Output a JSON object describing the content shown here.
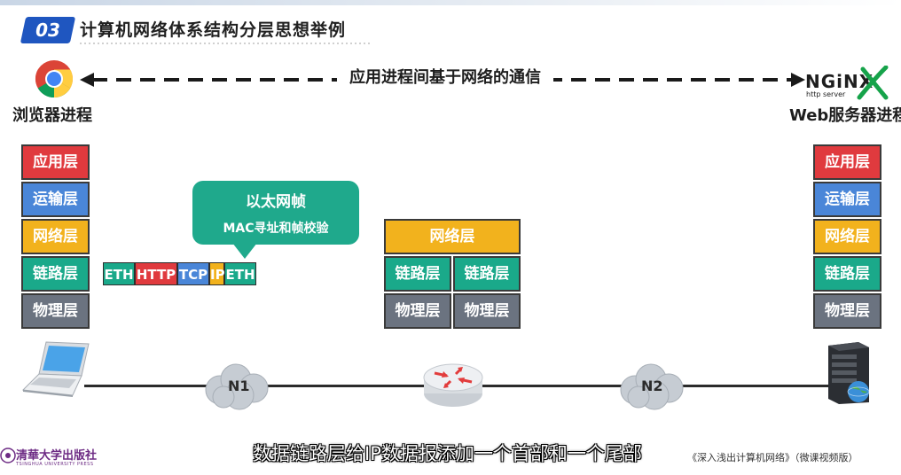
{
  "header": {
    "section_number": "03",
    "title": "计算机网络体系结构分层思想举例"
  },
  "communication": {
    "label": "应用进程间基于网络的通信"
  },
  "left_host": {
    "process_label": "浏览器进程",
    "icon": "chrome-browser-icon",
    "layers": [
      "应用层",
      "运输层",
      "网络层",
      "链路层",
      "物理层"
    ]
  },
  "right_host": {
    "process_label": "Web服务器进程",
    "logo_text": "NGiNX",
    "logo_subtext": "http server",
    "layers": [
      "应用层",
      "运输层",
      "网络层",
      "链路层",
      "物理层"
    ]
  },
  "frame": {
    "cells": [
      "ETH",
      "HTTP",
      "TCP",
      "IP",
      "ETH"
    ]
  },
  "callout": {
    "title": "以太网帧",
    "subtitle": "MAC寻址和帧校验"
  },
  "router": {
    "network_layer": "网络层",
    "ports": [
      {
        "link": "链路层",
        "physical": "物理层"
      },
      {
        "link": "链路层",
        "physical": "物理层"
      }
    ]
  },
  "networks": [
    "N1",
    "N2"
  ],
  "footer": {
    "subtitle": "数据链路层给IP数据报添加一个首部和一个尾部",
    "book": "《深入浅出计算机网络》（微课视频版）",
    "publisher": "清華大学出版社",
    "publisher_en": "TSINGHUA UNIVERSITY PRESS"
  },
  "colors": {
    "application": "#e03a3e",
    "transport": "#4a86d8",
    "network": "#f2b21d",
    "link": "#1aa98a",
    "physical": "#6b7380",
    "badge": "#1f56c0"
  }
}
